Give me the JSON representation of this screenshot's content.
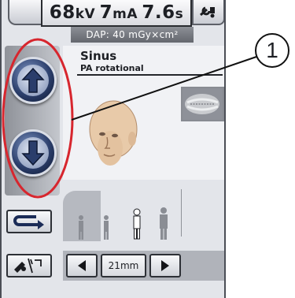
{
  "parameters": {
    "kv_value": "68",
    "kv_unit": "kV",
    "ma_value": "7",
    "ma_unit": "mA",
    "s_value": "7.6",
    "s_unit": "s"
  },
  "dap": "DAP: 40 mGy×cm²",
  "program": {
    "title": "Sinus",
    "subtitle": "PA rotational"
  },
  "zoom": {
    "value": "21mm"
  },
  "callout": {
    "label": "1"
  },
  "colors": {
    "highlight": "#d7262e",
    "button_blue": "#2c3f6c"
  },
  "icons": {
    "up": "arrow-up-icon",
    "down": "arrow-down-icon",
    "tool": "wrench-icon",
    "return": "return-arrow-icon",
    "patient": "patient-entry-icon"
  }
}
